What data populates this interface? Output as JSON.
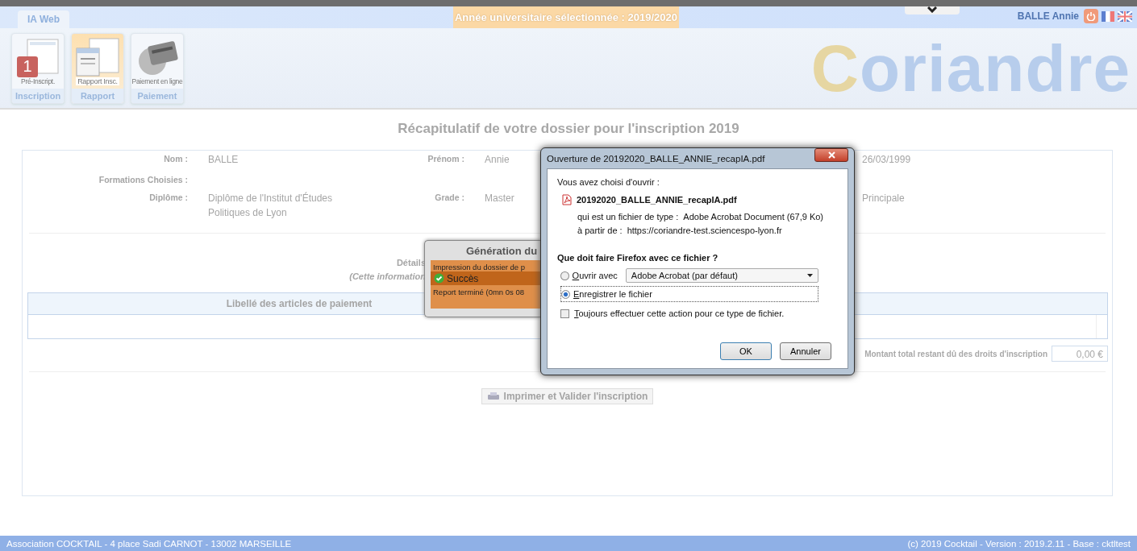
{
  "top_bar": {
    "tab": {
      "label": "IA Web",
      "selected": true
    },
    "year_banner": "Année universitaire sélectionnée : 2019/2020",
    "user": "BALLE Annie"
  },
  "toolbar": {
    "tiles": [
      {
        "caption": "Pré-Inscript.",
        "label": "Inscription",
        "badge": "1",
        "kind": "form",
        "selected": false
      },
      {
        "caption": "Rapport Insc.",
        "label": "Rapport",
        "kind": "report",
        "selected": true
      },
      {
        "caption": "Paiement en ligne",
        "label": "Paiement",
        "kind": "payment",
        "selected": false
      }
    ],
    "logo": "Coriandre"
  },
  "title": "Récapitulatif de votre dossier pour l'inscription 2019",
  "fields": [
    {
      "label": "Nom :",
      "value": "BALLE"
    },
    {
      "label": "Prénom :",
      "value": "Annie"
    },
    {
      "value": "26/03/1999"
    },
    {
      "label": "Formations Choisies :"
    },
    {
      "label": "Diplôme :",
      "value": "Diplôme de l'Institut d'Études Politiques de Lyon"
    },
    {
      "label": "Grade :",
      "value": "Master"
    },
    {
      "value": "Principale"
    }
  ],
  "details": {
    "title": "Détails",
    "note": "(Cette information"
  },
  "payment_table": {
    "columns": [
      "Libellé des articles de paiement"
    ]
  },
  "total": {
    "label": "Montant total restant dû des droits d'inscription",
    "value": "0,00 €"
  },
  "print_button": "Imprimer et Valider l'inscription",
  "footer": {
    "left": "Association COCKTAIL - 4 place Sadi CARNOT - 13002 MARSEILLE",
    "right": "(c) 2019 Cocktail - Version : 2019.2.11 - Base : cktltest"
  },
  "generation_popup": {
    "title": "Génération du",
    "line": "Impression du dossier de p",
    "status": "Succès",
    "report": "Report terminé (0mn 0s 08"
  },
  "dialog": {
    "title": "Ouverture de 20192020_BALLE_ANNIE_recapIA.pdf",
    "intro": "Vous avez choisi d'ouvrir :",
    "file_name": "20192020_BALLE_ANNIE_recapIA.pdf",
    "type_label": "qui est un fichier de type :",
    "type_value": "Adobe Acrobat Document (67,9 Ko)",
    "source_label": "à partir de :",
    "source_value": "https://coriandre-test.sciencespo-lyon.fr",
    "question": "Que doit faire Firefox avec ce fichier ?",
    "options": [
      {
        "label": "Ouvrir avec",
        "selected": false,
        "app": "Adobe Acrobat  (par défaut)"
      },
      {
        "label": "Enregistrer le fichier",
        "selected": true
      }
    ],
    "always": {
      "label": "Toujours effectuer cette action pour ce type de fichier.",
      "checked": false
    },
    "buttons": [
      "OK",
      "Annuler"
    ]
  }
}
